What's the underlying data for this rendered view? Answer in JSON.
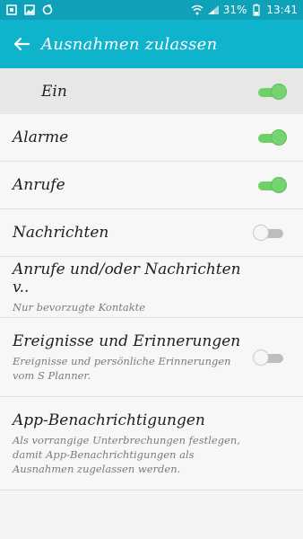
{
  "status_bar": {
    "icons_left": [
      "notification-box-icon",
      "image-icon",
      "sync-icon"
    ],
    "battery": "31%",
    "time": "13:41"
  },
  "app_bar": {
    "title": "Ausnahmen zulassen"
  },
  "master": {
    "label": "Ein",
    "state": "on"
  },
  "items": [
    {
      "label": "Alarme",
      "state": "on"
    },
    {
      "label": "Anrufe",
      "state": "on"
    },
    {
      "label": "Nachrichten",
      "state": "off"
    },
    {
      "label": "Anrufe und/oder Nachrichten v..",
      "subtitle": "Nur bevorzugte Kontakte"
    },
    {
      "label": "Ereignisse und Erinnerungen",
      "subtitle": "Ereignisse und persönliche Erinnerungen vom S Planner.",
      "state": "off"
    },
    {
      "label": "App-Benachrichtigungen",
      "subtitle": "Als vorrangige Unterbrechungen festlegen, damit App-Benachrichtigungen als Ausnahmen zugelassen werden."
    }
  ],
  "colors": {
    "status_bar": "#0fa1b8",
    "app_bar": "#10b3cc",
    "toggle_on": "#6fd06a"
  }
}
